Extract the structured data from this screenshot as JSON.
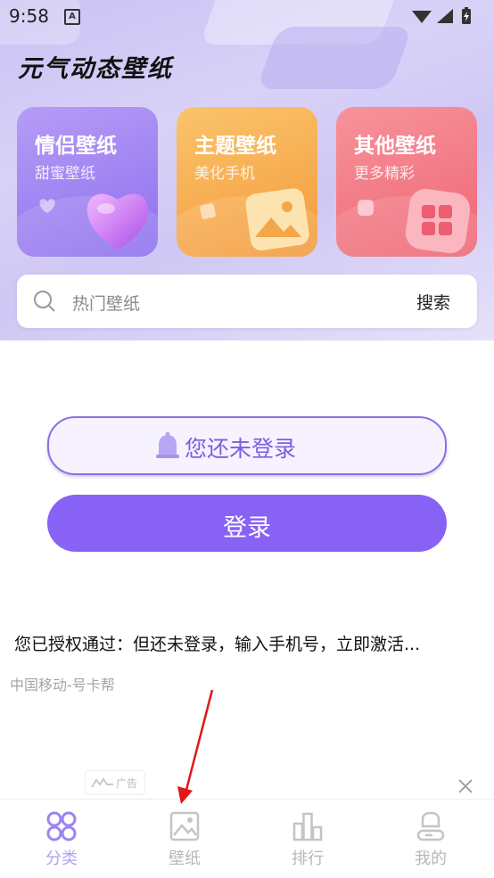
{
  "status": {
    "time": "9:58",
    "indicator": "A"
  },
  "app": {
    "title": "元气动态壁纸"
  },
  "cards": [
    {
      "title": "情侣壁纸",
      "subtitle": "甜蜜壁纸",
      "icon": "heart-icon",
      "color": "#9a7bf0"
    },
    {
      "title": "主题壁纸",
      "subtitle": "美化手机",
      "icon": "image-icon",
      "color": "#f7a94a"
    },
    {
      "title": "其他壁纸",
      "subtitle": "更多精彩",
      "icon": "grid-icon",
      "color": "#f0757f"
    }
  ],
  "search": {
    "placeholder": "热门壁纸",
    "button": "搜索"
  },
  "login_notice": {
    "text": "您还未登录"
  },
  "login_button": {
    "label": "登录"
  },
  "auth_text": "您已授权通过：但还未登录，输入手机号，立即激活...",
  "carrier_text": "中国移动-号卡帮",
  "ad": {
    "label": "广告"
  },
  "tabs": [
    {
      "label": "分类",
      "icon": "category-icon",
      "active": true
    },
    {
      "label": "壁纸",
      "icon": "wallpaper-icon",
      "active": false
    },
    {
      "label": "排行",
      "icon": "ranking-icon",
      "active": false
    },
    {
      "label": "我的",
      "icon": "profile-icon",
      "active": false
    }
  ],
  "colors": {
    "accent": "#8762f5",
    "accent_light": "#b3a2ef",
    "annotation": "#e01818"
  }
}
